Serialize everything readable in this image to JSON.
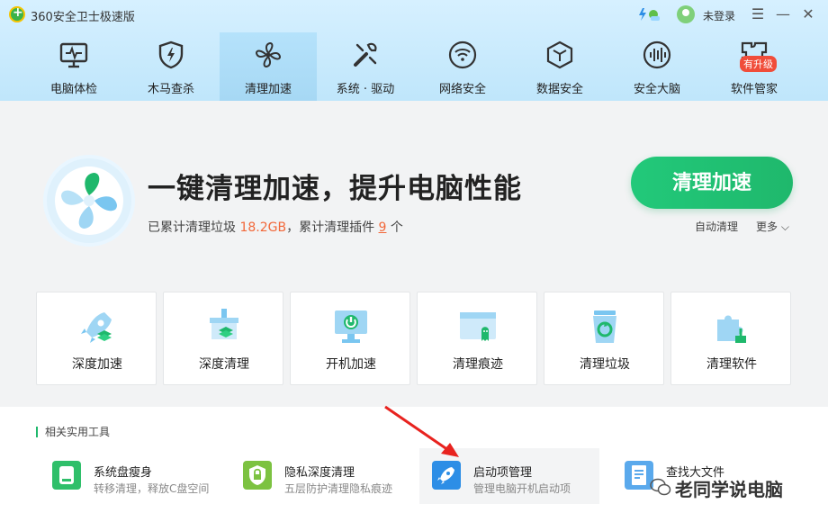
{
  "app": {
    "title": "360安全卫士极速版",
    "login": "未登录"
  },
  "nav": [
    {
      "label": "电脑体检",
      "icon": "monitor-pulse-icon"
    },
    {
      "label": "木马查杀",
      "icon": "shield-bolt-icon"
    },
    {
      "label": "清理加速",
      "icon": "fan-icon",
      "active": true
    },
    {
      "label": "系统 · 驱动",
      "icon": "tools-icon"
    },
    {
      "label": "网络安全",
      "icon": "wifi-icon"
    },
    {
      "label": "数据安全",
      "icon": "cube-icon"
    },
    {
      "label": "安全大脑",
      "icon": "brain-icon"
    },
    {
      "label": "软件管家",
      "icon": "apps-icon"
    }
  ],
  "nav_badge": "有升级",
  "hero": {
    "headline": "一键清理加速，提升电脑性能",
    "stats_prefix": "已累计清理垃圾 ",
    "stats_garbage": "18.2GB",
    "stats_mid": "，累计清理插件 ",
    "stats_plugins": "9",
    "stats_suffix": " 个",
    "cta": "清理加速",
    "auto_clean": "自动清理",
    "more": "更多"
  },
  "cards": [
    {
      "label": "深度加速"
    },
    {
      "label": "深度清理"
    },
    {
      "label": "开机加速"
    },
    {
      "label": "清理痕迹"
    },
    {
      "label": "清理垃圾"
    },
    {
      "label": "清理软件"
    }
  ],
  "tools": {
    "title": "相关实用工具",
    "items": [
      {
        "name": "系统盘瘦身",
        "desc": "转移清理，释放C盘空间"
      },
      {
        "name": "隐私深度清理",
        "desc": "五层防护清理隐私痕迹"
      },
      {
        "name": "启动项管理",
        "desc": "管理电脑开机启动项"
      },
      {
        "name": "查找大文件",
        "desc": ""
      }
    ]
  },
  "watermark": "老同学说电脑",
  "colors": {
    "accent_green": "#1fb86c",
    "highlight_orange": "#f2683a",
    "arrow_red": "#e8231f"
  }
}
